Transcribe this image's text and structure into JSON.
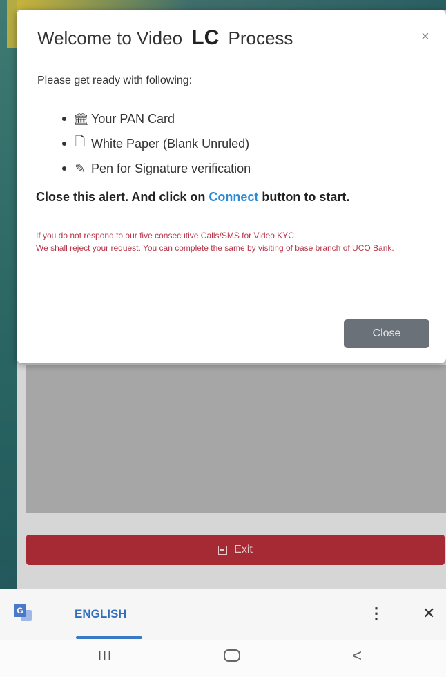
{
  "modal": {
    "title_prefix": "Welcome to Video",
    "title_highlight": "LC",
    "title_suffix": "Process",
    "close_symbol": "×",
    "lead": "Please get ready with following:",
    "items": [
      {
        "icon": "bank-icon",
        "glyph": "🏛",
        "label": "Your PAN Card"
      },
      {
        "icon": "document-icon",
        "glyph": "🗋",
        "label": "White Paper (Blank Unruled)"
      },
      {
        "icon": "pen-icon",
        "glyph": "✎",
        "label": "Pen for Signature verification"
      }
    ],
    "instruction_before": "Close this alert. And click on",
    "instruction_link": "Connect",
    "instruction_after": "button to start.",
    "warning_line1": "If you do not respond to our five consecutive Calls/SMS for Video KYC.",
    "warning_line2": "We shall reject your request. You can complete the same by visiting of base branch of UCO Bank.",
    "close_button": "Close"
  },
  "app": {
    "exit_label": "Exit"
  },
  "translate_bar": {
    "language": "ENGLISH",
    "more_symbol": "⋮",
    "close_symbol": "✕"
  },
  "nav": {
    "recents_symbol": "III",
    "back_symbol": "<"
  },
  "colors": {
    "link": "#2d8bd6",
    "warning": "#b8364a",
    "exit_button": "#a52a34",
    "close_button": "#6b7178"
  }
}
